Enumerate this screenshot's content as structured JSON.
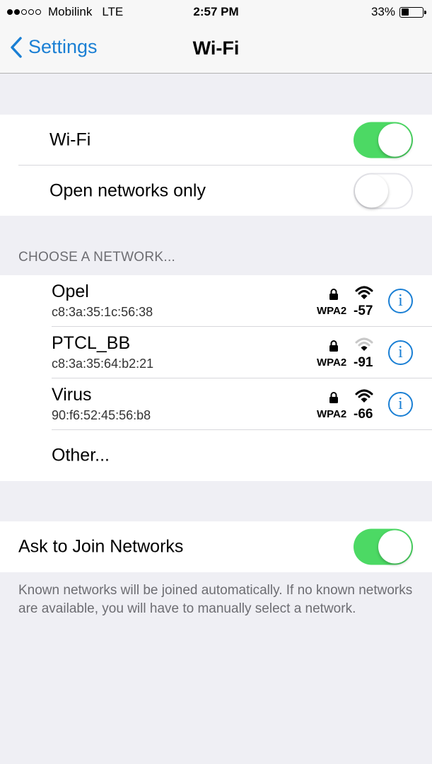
{
  "status_bar": {
    "signal_dots_filled": 2,
    "signal_dots_total": 5,
    "carrier": "Mobilink",
    "network_type": "LTE",
    "time": "2:57 PM",
    "battery_percent": "33%",
    "battery_level": 0.33
  },
  "nav": {
    "back_label": "Settings",
    "title": "Wi-Fi"
  },
  "wifi_group": {
    "wifi_label": "Wi-Fi",
    "wifi_on": true,
    "open_only_label": "Open networks only",
    "open_only_on": false
  },
  "choose_header": "CHOOSE A NETWORK...",
  "networks": [
    {
      "name": "Opel",
      "mac": "c8:3a:35:1c:56:38",
      "security": "WPA2",
      "rssi": "-57",
      "strength": "strong",
      "locked": true
    },
    {
      "name": "PTCL_BB",
      "mac": "c8:3a:35:64:b2:21",
      "security": "WPA2",
      "rssi": "-91",
      "strength": "weak",
      "locked": true
    },
    {
      "name": "Virus",
      "mac": "90:f6:52:45:56:b8",
      "security": "WPA2",
      "rssi": "-66",
      "strength": "strong",
      "locked": true
    }
  ],
  "other_label": "Other...",
  "ask_group": {
    "label": "Ask to Join Networks",
    "on": true
  },
  "footer_text": "Known networks will be joined automatically. If no known networks are available, you will have to manually select a network.",
  "colors": {
    "accent": "#1a7fd4",
    "toggle_on": "#4cd964",
    "background": "#efeff4"
  }
}
